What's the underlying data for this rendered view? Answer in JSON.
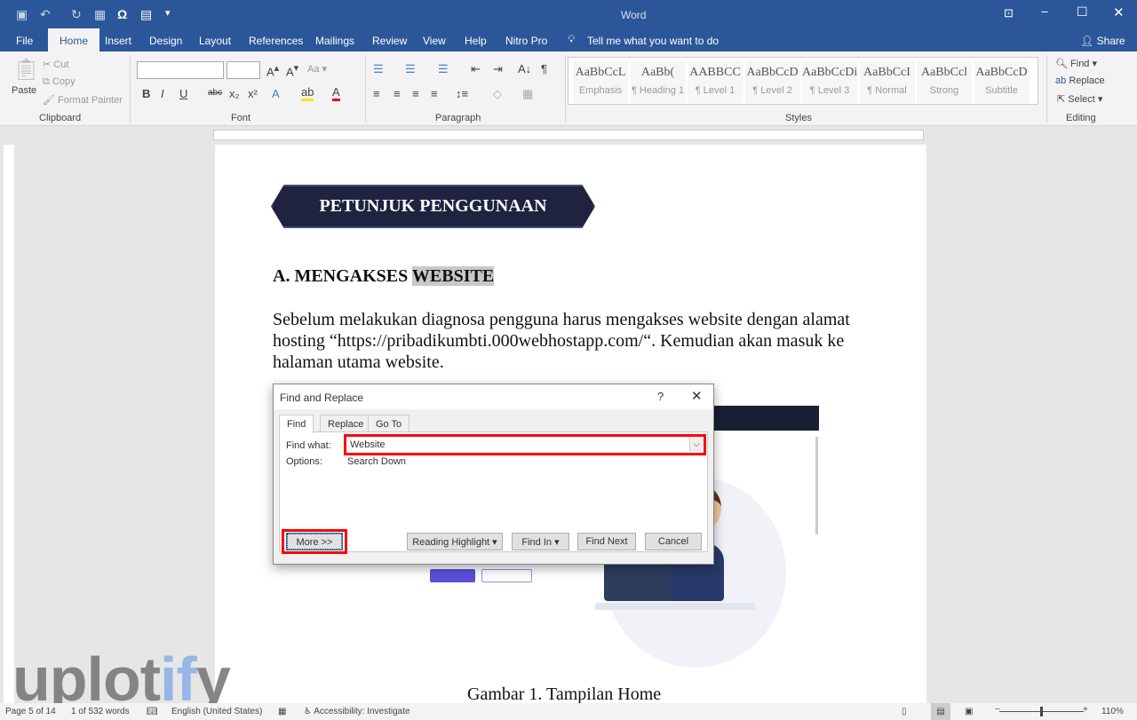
{
  "window": {
    "title": "Word",
    "share": "Share",
    "tell_me": "Tell me what you want to do"
  },
  "tabs": [
    "File",
    "Home",
    "Insert",
    "Design",
    "Layout",
    "References",
    "Mailings",
    "Review",
    "View",
    "Help",
    "Nitro Pro"
  ],
  "clipboard": {
    "paste": "Paste",
    "cut": "Cut",
    "copy": "Copy",
    "format_painter": "Format Painter",
    "label": "Clipboard"
  },
  "font": {
    "label": "Font",
    "name": "",
    "size": ""
  },
  "paragraph": {
    "label": "Paragraph"
  },
  "styles": {
    "label": "Styles",
    "items": [
      {
        "preview": "AaBbCcL",
        "name": "Emphasis"
      },
      {
        "preview": "AaBb(",
        "name": "¶ Heading 1"
      },
      {
        "preview": "AABBCC",
        "name": "¶ Level 1"
      },
      {
        "preview": "AaBbCcD",
        "name": "¶ Level 2"
      },
      {
        "preview": "AaBbCcDi",
        "name": "¶ Level 3"
      },
      {
        "preview": "AaBbCcI",
        "name": "¶ Normal"
      },
      {
        "preview": "AaBbCcl",
        "name": "Strong"
      },
      {
        "preview": "AaBbCcD",
        "name": "Subtitle"
      }
    ]
  },
  "editing": {
    "label": "Editing",
    "find": "Find",
    "replace": "Replace",
    "select": "Select"
  },
  "document": {
    "banner": "PETUNJUK PENGGUNAAN",
    "heading_prefix": "A. MENGAKSES ",
    "heading_highlight": "WEBSITE",
    "paragraph": "Sebelum melakukan diagnosa pengguna harus mengakses website dengan alamat hosting “https://pribadikumbti.000webhostapp.com/“. Kemudian akan masuk ke halaman utama website.",
    "caption": "Gambar 1. Tampilan Home"
  },
  "dialog": {
    "title": "Find and Replace",
    "help": "?",
    "tabs": [
      "Find",
      "Replace",
      "Go To"
    ],
    "find_label": "Find what:",
    "find_value": "Website",
    "options_label": "Options:",
    "options_value": "Search Down",
    "buttons": {
      "more": "More >>",
      "reading_highlight": "Reading Highlight ▾",
      "find_in": "Find In ▾",
      "find_next": "Find Next",
      "cancel": "Cancel"
    }
  },
  "status": {
    "page": "Page 5 of 14",
    "words": "1 of 532 words",
    "language": "English (United States)",
    "accessibility": "Accessibility: Investigate",
    "zoom": "110%"
  },
  "watermark": "uplotify",
  "colors": {
    "accent": "#2b579a",
    "highlight_box": "#ff0000",
    "banner": "#1f2340"
  }
}
